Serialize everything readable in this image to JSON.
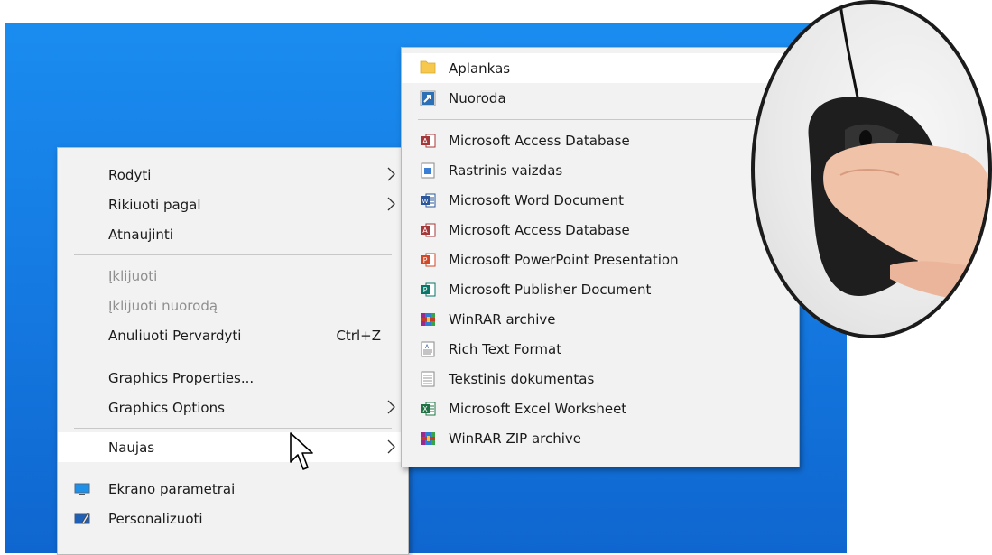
{
  "context_menu": {
    "items": [
      {
        "label": "Rodyti"
      },
      {
        "label": "Rikiuoti pagal"
      },
      {
        "label": "Atnaujinti"
      },
      {
        "label": "Įklijuoti"
      },
      {
        "label": "Įklijuoti nuorodą"
      },
      {
        "label": "Anuliuoti Pervardyti",
        "shortcut": "Ctrl+Z"
      },
      {
        "label": "Graphics Properties..."
      },
      {
        "label": "Graphics Options"
      },
      {
        "label": "Naujas"
      },
      {
        "label": "Ekrano parametrai",
        "icon": "display-icon"
      },
      {
        "label": "Personalizuoti",
        "icon": "personalize-icon"
      }
    ]
  },
  "new_submenu": {
    "items": [
      {
        "label": "Aplankas",
        "icon": "folder-icon"
      },
      {
        "label": "Nuoroda",
        "icon": "shortcut-icon"
      },
      {
        "label": "Microsoft Access Database",
        "icon": "access-icon"
      },
      {
        "label": "Rastrinis vaizdas",
        "icon": "bitmap-icon"
      },
      {
        "label": "Microsoft Word Document",
        "icon": "word-icon"
      },
      {
        "label": "Microsoft Access Database",
        "icon": "access-icon"
      },
      {
        "label": "Microsoft PowerPoint Presentation",
        "icon": "powerpoint-icon"
      },
      {
        "label": "Microsoft Publisher Document",
        "icon": "publisher-icon"
      },
      {
        "label": "WinRAR archive",
        "icon": "winrar-icon"
      },
      {
        "label": "Rich Text Format",
        "icon": "rtf-icon"
      },
      {
        "label": "Tekstinis dokumentas",
        "icon": "text-document-icon"
      },
      {
        "label": "Microsoft Excel Worksheet",
        "icon": "excel-icon"
      },
      {
        "label": "WinRAR ZIP archive",
        "icon": "winrar-zip-icon"
      }
    ]
  },
  "colors": {
    "desktop": "#1478e0",
    "menu_bg": "#f2f2f2",
    "highlight": "#ffffff",
    "disabled_text": "#8f8f8f",
    "access": "#a4373a",
    "word": "#2b579a",
    "powerpoint": "#d24726",
    "publisher": "#077568",
    "excel": "#217346"
  }
}
